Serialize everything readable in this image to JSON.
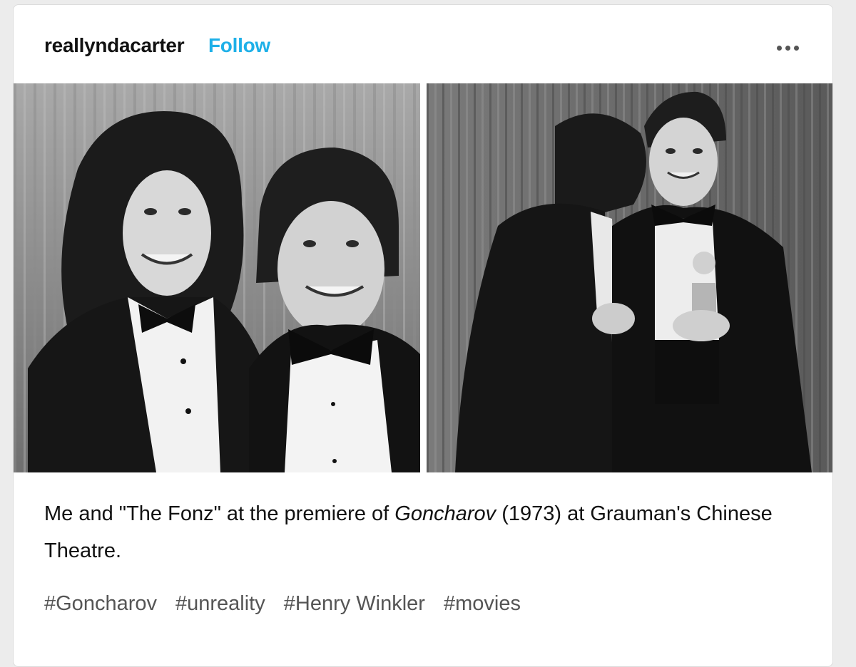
{
  "post": {
    "username": "reallyndacarter",
    "follow_label": "Follow",
    "more_icon": "ellipsis-icon",
    "photos": [
      {
        "alt": "left-photo"
      },
      {
        "alt": "right-photo"
      }
    ],
    "caption": {
      "part1": "Me and \"The Fonz\" at the premiere of ",
      "title": "Goncharov",
      "part2": " (1973) at Grauman's Chinese Theatre."
    },
    "tags": [
      "#Goncharov",
      "#unreality",
      "#Henry Winkler",
      "#movies"
    ],
    "colors": {
      "follow": "#1eb0e8",
      "text": "#111111",
      "tags": "#555555"
    }
  }
}
